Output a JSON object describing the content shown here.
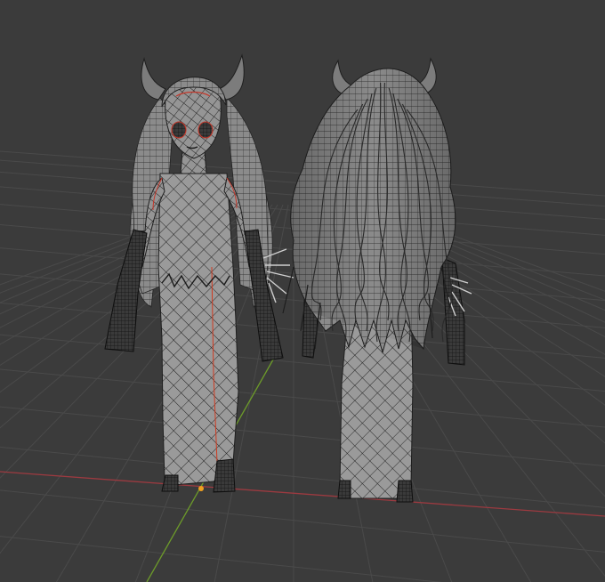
{
  "viewport": {
    "background": "#3b3b3b",
    "grid_color": "#4a4a4a",
    "axis_x_color": "#a03a3f",
    "axis_y_color": "#6a9a2a",
    "origin_color": "#f0a020"
  },
  "models": [
    {
      "name": "character-front-view",
      "view": "front"
    },
    {
      "name": "character-back-view",
      "view": "back"
    }
  ],
  "mesh": {
    "surface_color": "#8e8e8e",
    "wire_color": "#1c1c1c",
    "seam_color": "#d0381e",
    "horn_color": "#7a7a7a"
  }
}
